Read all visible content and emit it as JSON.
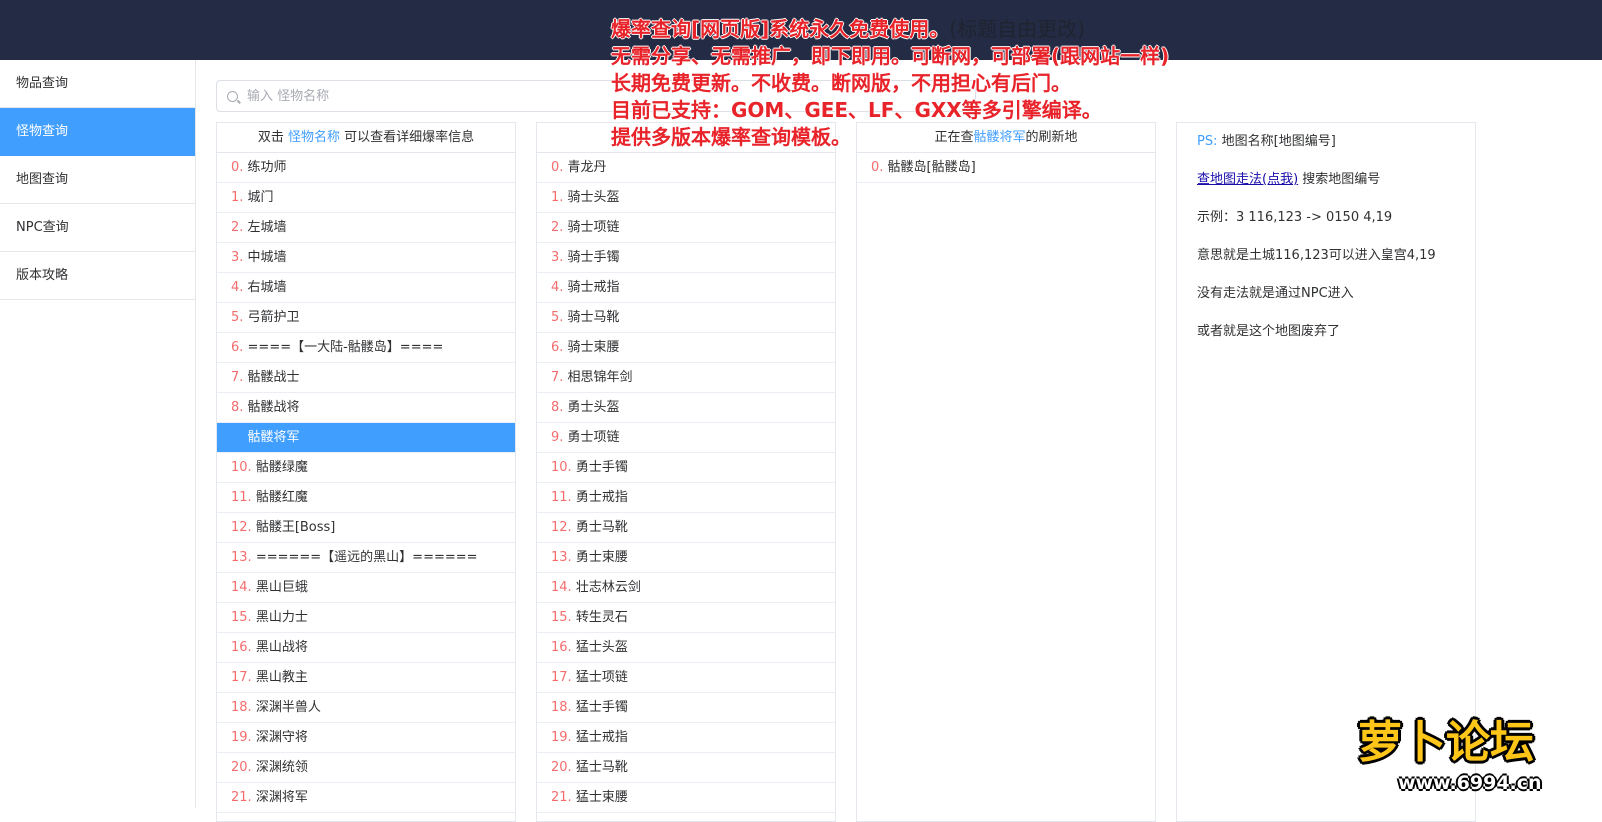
{
  "sidebar": {
    "items": [
      {
        "label": "物品查询",
        "active": false
      },
      {
        "label": "怪物查询",
        "active": true
      },
      {
        "label": "地图查询",
        "active": false
      },
      {
        "label": "NPC查询",
        "active": false
      },
      {
        "label": "版本攻略",
        "active": false
      }
    ]
  },
  "search": {
    "placeholder": "输入 怪物名称",
    "value": ""
  },
  "monsters": {
    "header_pre": "双击 ",
    "header_link": "怪物名称",
    "header_post": " 可以查看详细爆率信息",
    "selected_index": 9,
    "items": [
      {
        "idx": "0.",
        "name": " 练功师"
      },
      {
        "idx": "1.",
        "name": " 城门"
      },
      {
        "idx": "2.",
        "name": " 左城墙"
      },
      {
        "idx": "3.",
        "name": " 中城墙"
      },
      {
        "idx": "4.",
        "name": " 右城墙"
      },
      {
        "idx": "5.",
        "name": " 弓箭护卫"
      },
      {
        "idx": "6.",
        "name": " ====【一大陆-骷髅岛】===="
      },
      {
        "idx": "7.",
        "name": " 骷髅战士"
      },
      {
        "idx": "8.",
        "name": " 骷髅战将"
      },
      {
        "idx": "9.",
        "name": " 骷髅将军"
      },
      {
        "idx": "10.",
        "name": " 骷髅绿魔"
      },
      {
        "idx": "11.",
        "name": " 骷髅红魔"
      },
      {
        "idx": "12.",
        "name": " 骷髅王[Boss]"
      },
      {
        "idx": "13.",
        "name": " ======【遥远的黑山】======"
      },
      {
        "idx": "14.",
        "name": " 黑山巨蛾"
      },
      {
        "idx": "15.",
        "name": " 黑山力士"
      },
      {
        "idx": "16.",
        "name": " 黑山战将"
      },
      {
        "idx": "17.",
        "name": " 黑山教主"
      },
      {
        "idx": "18.",
        "name": " 深渊半兽人"
      },
      {
        "idx": "19.",
        "name": " 深渊守将"
      },
      {
        "idx": "20.",
        "name": " 深渊统领"
      },
      {
        "idx": "21.",
        "name": " 深渊将军"
      }
    ]
  },
  "drops": {
    "header": "",
    "items": [
      {
        "idx": "0.",
        "name": " 青龙丹"
      },
      {
        "idx": "1.",
        "name": " 骑士头盔"
      },
      {
        "idx": "2.",
        "name": " 骑士项链"
      },
      {
        "idx": "3.",
        "name": " 骑士手镯"
      },
      {
        "idx": "4.",
        "name": " 骑士戒指"
      },
      {
        "idx": "5.",
        "name": " 骑士马靴"
      },
      {
        "idx": "6.",
        "name": " 骑士束腰"
      },
      {
        "idx": "7.",
        "name": " 相思锦年剑"
      },
      {
        "idx": "8.",
        "name": " 勇士头盔"
      },
      {
        "idx": "9.",
        "name": " 勇士项链"
      },
      {
        "idx": "10.",
        "name": " 勇士手镯"
      },
      {
        "idx": "11.",
        "name": " 勇士戒指"
      },
      {
        "idx": "12.",
        "name": " 勇士马靴"
      },
      {
        "idx": "13.",
        "name": " 勇士束腰"
      },
      {
        "idx": "14.",
        "name": " 壮志林云剑"
      },
      {
        "idx": "15.",
        "name": " 转生灵石"
      },
      {
        "idx": "16.",
        "name": " 猛士头盔"
      },
      {
        "idx": "17.",
        "name": " 猛士项链"
      },
      {
        "idx": "18.",
        "name": " 猛士手镯"
      },
      {
        "idx": "19.",
        "name": " 猛士戒指"
      },
      {
        "idx": "20.",
        "name": " 猛士马靴"
      },
      {
        "idx": "21.",
        "name": " 猛士束腰"
      }
    ]
  },
  "maps": {
    "header_pre": "正在查",
    "header_link": "骷髅将军",
    "header_post": "的刷新地",
    "items": [
      {
        "idx": "0.",
        "name": " 骷髅岛[骷髅岛]"
      }
    ]
  },
  "info": {
    "ps_label": "PS:",
    "ps_text": " 地图名称[地图编号]",
    "link_text": "查地图走法(点我)",
    "link_after": " 搜索地图编号",
    "example": "示例：3 116,123 -> 0150 4,19",
    "meaning": "意思就是土城116,123可以进入皇宫4,19",
    "no_route": "没有走法就是通过NPC进入",
    "abandoned": "或者就是这个地图废弃了"
  },
  "overlay": {
    "line1_red": "爆率查询[网页版]系统永久免费使用。",
    "line1_plain": "(标题自由更改)",
    "line2": "无需分享、无需推广，即下即用。可断网，可部署(跟网站一样)",
    "line3": "长期免费更新。不收费。断网版，不用担心有后门。",
    "line4": "目前已支持：GOM、GEE、LF、GXX等多引擎编译。",
    "line5": "提供多版本爆率查询模板。"
  },
  "watermark": {
    "brand": "萝卜论坛",
    "url": "www.6994.cn"
  },
  "colors": {
    "topbar": "#232b45",
    "accent": "#409eff",
    "index": "#f56c6c",
    "overlay_red": "#e8232a",
    "logo_yellow": "#ffc61a"
  }
}
